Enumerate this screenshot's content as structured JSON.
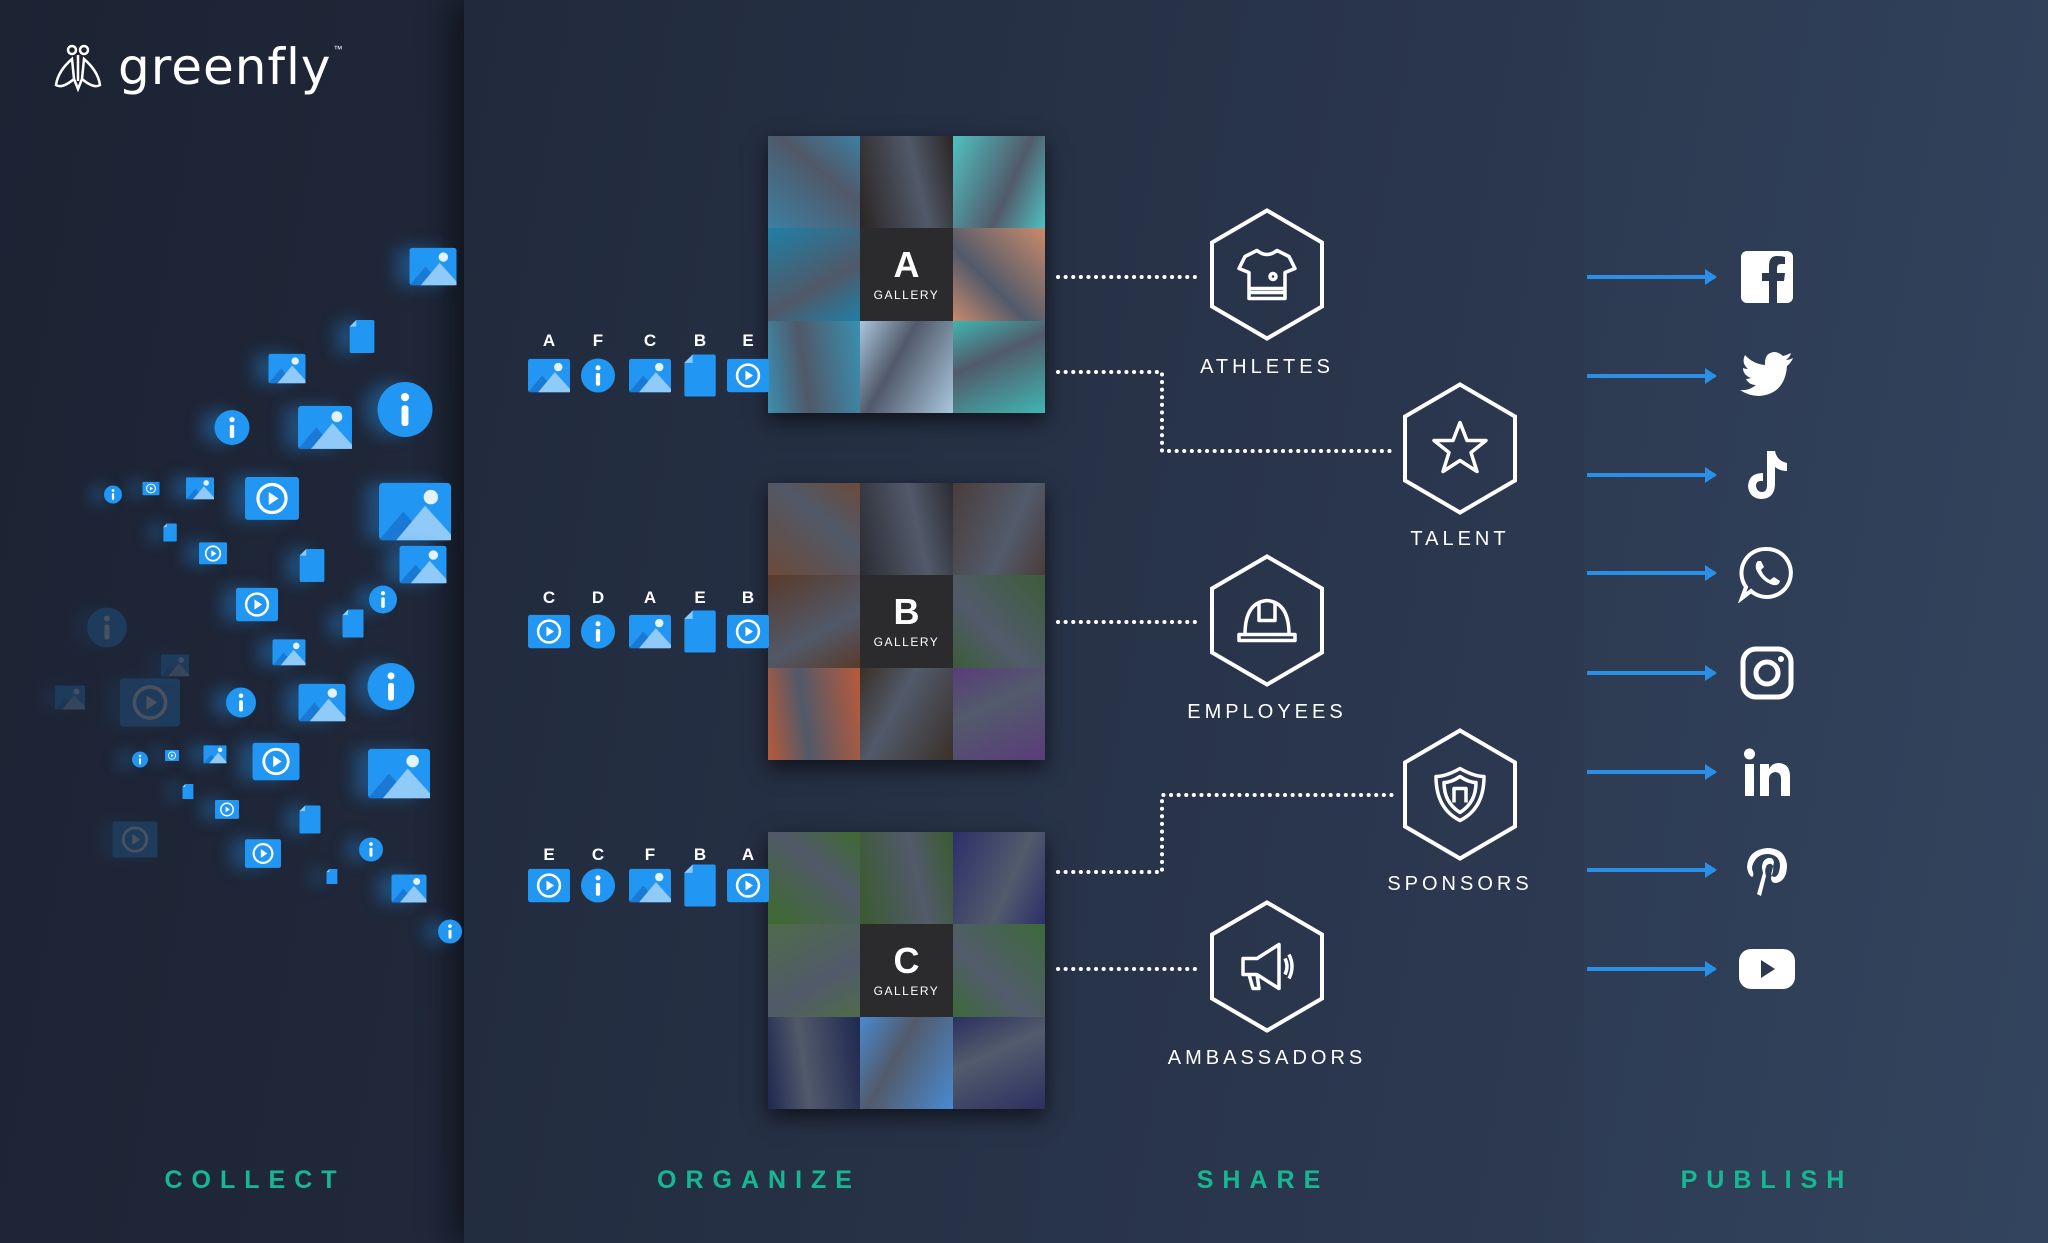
{
  "brand": {
    "name": "greenfly",
    "tm": "™"
  },
  "stages": [
    "COLLECT",
    "ORGANIZE",
    "SHARE",
    "PUBLISH"
  ],
  "galleries": [
    {
      "letter": "A",
      "caption": "GALLERY",
      "asset_labels": [
        "A",
        "F",
        "C",
        "B",
        "E"
      ],
      "asset_icons": [
        "image",
        "info",
        "image",
        "file",
        "video"
      ],
      "tile_colors": [
        "#3d7fa3",
        "#2b2523",
        "#4fc1c0",
        "#1f7fa6",
        "center",
        "#c98a6b",
        "#3a8fb0",
        "#a9c6dd",
        "#3fb5b0"
      ]
    },
    {
      "letter": "B",
      "caption": "GALLERY",
      "asset_labels": [
        "C",
        "D",
        "A",
        "E",
        "B"
      ],
      "asset_icons": [
        "video",
        "info",
        "image",
        "file",
        "video"
      ],
      "tile_colors": [
        "#6b4a3a",
        "#2c2c33",
        "#4a3d3a",
        "#5a3a2a",
        "center",
        "#3c5c3a",
        "#b85a3a",
        "#3a3028",
        "#5a3c7a"
      ]
    },
    {
      "letter": "C",
      "caption": "GALLERY",
      "asset_labels": [
        "E",
        "C",
        "F",
        "B",
        "A"
      ],
      "asset_icons": [
        "video",
        "info",
        "image",
        "file",
        "video"
      ],
      "tile_colors": [
        "#3d6b2e",
        "#3a5b2e",
        "#2c2f6a",
        "#4f6b4a",
        "center",
        "#3c6a3a",
        "#1f2850",
        "#4a8ad0",
        "#2b3060"
      ]
    }
  ],
  "audiences": [
    {
      "label": "ATHLETES",
      "icon": "shirt-icon"
    },
    {
      "label": "TALENT",
      "icon": "star-icon"
    },
    {
      "label": "EMPLOYEES",
      "icon": "hard-hat-icon"
    },
    {
      "label": "SPONSORS",
      "icon": "shield-icon"
    },
    {
      "label": "AMBASSADORS",
      "icon": "megaphone-icon"
    }
  ],
  "channels": [
    "facebook",
    "twitter",
    "tiktok",
    "whatsapp",
    "instagram",
    "linkedin",
    "pinterest",
    "youtube"
  ],
  "colors": {
    "accent_blue": "#2a8fe6",
    "stage_green": "#16b894",
    "icon_blue": "#2196f3"
  }
}
